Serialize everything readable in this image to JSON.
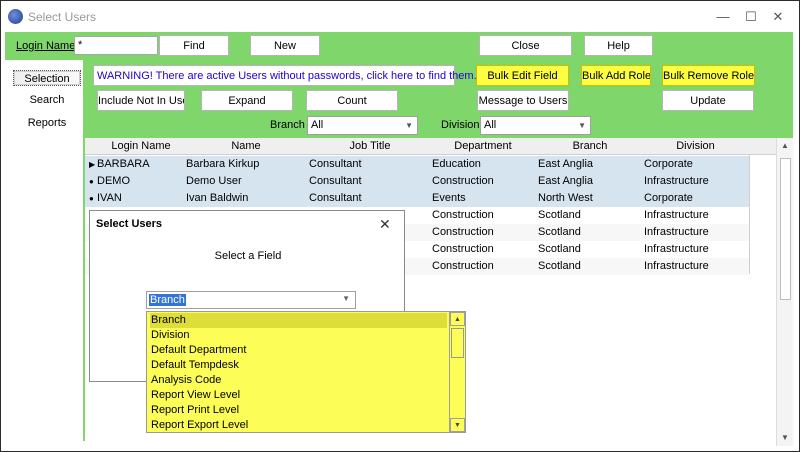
{
  "window": {
    "title": "Select Users",
    "controls": {
      "minimize": "—",
      "maximize": "☐",
      "close": "✕"
    }
  },
  "toolbar": {
    "login_name_label": "Login Name",
    "login_name_value": "*",
    "find": "Find",
    "new": "New",
    "close": "Close",
    "help": "Help"
  },
  "nav": {
    "items": [
      {
        "label": "Selection"
      },
      {
        "label": "Search"
      },
      {
        "label": "Reports"
      }
    ]
  },
  "actions": {
    "warning": "WARNING! There are active Users without passwords, click here to find them.",
    "include_not_in_use": "Include Not In Use",
    "expand": "Expand",
    "count": "Count",
    "message_to_users": "Message to Users",
    "update": "Update",
    "bulk_edit_field": "Bulk Edit Field",
    "bulk_add_role": "Bulk Add Role",
    "bulk_remove_role": "Bulk Remove Role"
  },
  "filters": {
    "branch_label": "Branch",
    "branch_value": "All",
    "division_label": "Division",
    "division_value": "All"
  },
  "table": {
    "columns": [
      "Login Name",
      "Name",
      "Job Title",
      "Department",
      "Branch",
      "Division"
    ],
    "rows": [
      {
        "marker": "▶",
        "login": "BARBARA",
        "name": "Barbara Kirkup",
        "job": "Consultant",
        "dept": "Education",
        "branch": "East Anglia",
        "division": "Corporate"
      },
      {
        "marker": "●",
        "login": "DEMO",
        "name": "Demo User",
        "job": "Consultant",
        "dept": "Construction",
        "branch": "East Anglia",
        "division": "Infrastructure"
      },
      {
        "marker": "●",
        "login": "IVAN",
        "name": "Ivan Baldwin",
        "job": "Consultant",
        "dept": "Events",
        "branch": "North West",
        "division": "Corporate"
      },
      {
        "marker": "",
        "login": "",
        "name": "",
        "job": "",
        "dept": "Construction",
        "branch": "Scotland",
        "division": "Infrastructure"
      },
      {
        "marker": "",
        "login": "",
        "name": "",
        "job": "",
        "dept": "Construction",
        "branch": "Scotland",
        "division": "Infrastructure"
      },
      {
        "marker": "",
        "login": "",
        "name": "",
        "job": "",
        "dept": "Construction",
        "branch": "Scotland",
        "division": "Infrastructure"
      },
      {
        "marker": "",
        "login": "",
        "name": "",
        "job": "",
        "dept": "Construction",
        "branch": "Scotland",
        "division": "Infrastructure"
      }
    ]
  },
  "dialog": {
    "title": "Select Users",
    "close": "✕",
    "prompt": "Select a Field",
    "selected_field": "Branch",
    "options": [
      "Branch",
      "Division",
      "Default Department",
      "Default Tempdesk",
      "Analysis Code",
      "Report View Level",
      "Report Print Level",
      "Report Export Level"
    ]
  },
  "icons": {
    "app": "app-globe-icon",
    "scroll_up": "▲",
    "scroll_down": "▼",
    "dropdown_caret": "▼"
  },
  "colors": {
    "toolbar_green": "#7fd66b",
    "highlight_yellow": "#fdfd42",
    "selected_row_blue": "#d6e4ef",
    "warning_text": "#2200cc"
  }
}
